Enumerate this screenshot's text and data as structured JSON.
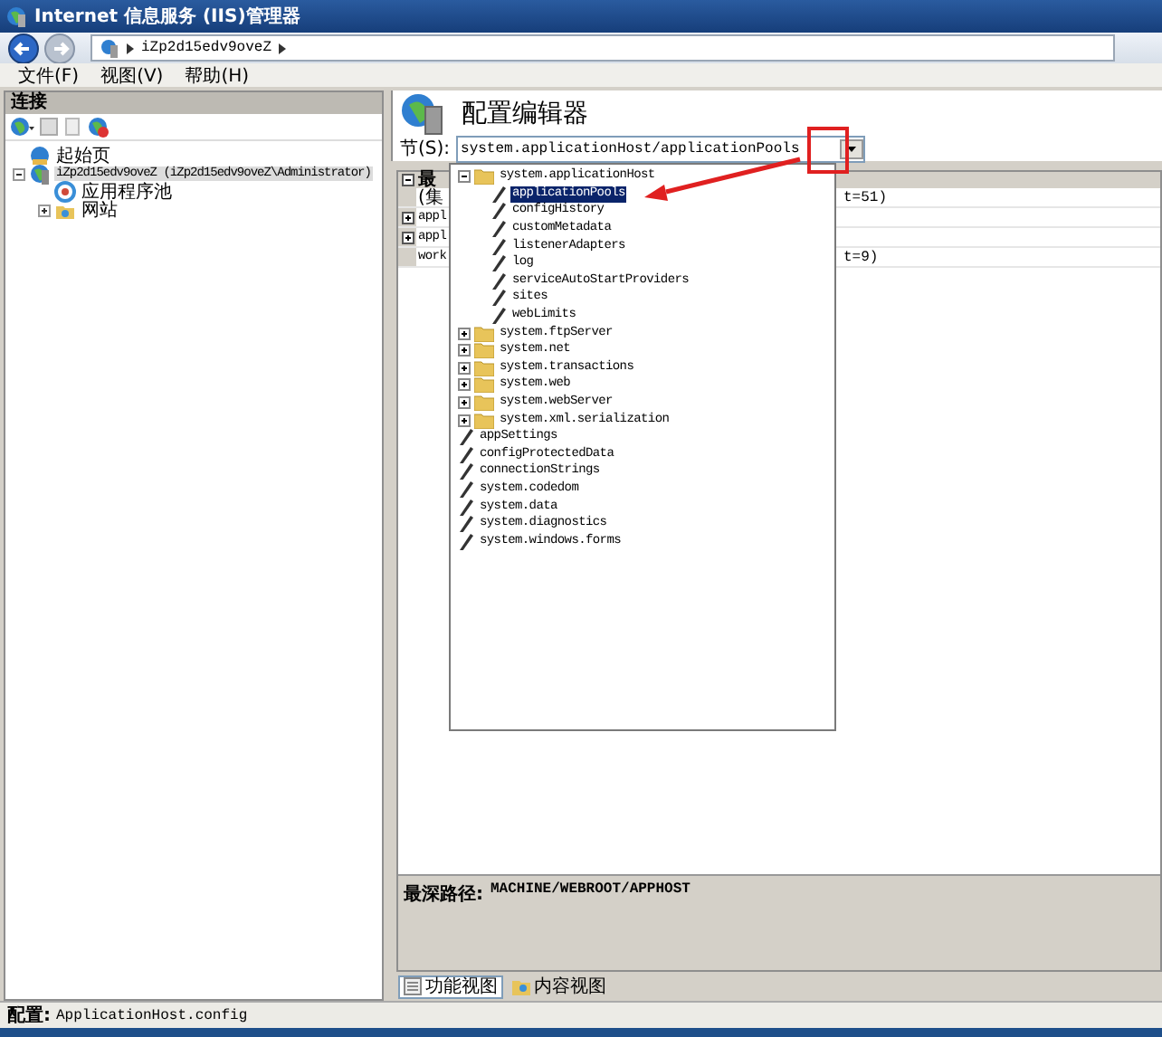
{
  "window": {
    "title": "Internet 信息服务 (IIS)管理器"
  },
  "address": {
    "segments": [
      "iZp2d15edv9oveZ"
    ]
  },
  "menu": [
    "文件(F)",
    "视图(V)",
    "帮助(H)"
  ],
  "connections": {
    "title": "连接",
    "tree": [
      {
        "label": "起始页",
        "kind": "start",
        "selected": false
      },
      {
        "label": "iZp2d15edv9oveZ (iZp2d15edv9oveZ\\Administrator)",
        "kind": "server",
        "expanded": true,
        "selected": true,
        "children": [
          {
            "label": "应用程序池",
            "kind": "pools",
            "selected": false
          },
          {
            "label": "网站",
            "kind": "sites",
            "expanded": false,
            "selected": false
          }
        ]
      }
    ]
  },
  "editor": {
    "title": "配置编辑器",
    "section_label": "节(S):",
    "section_value": "system.applicationHost/applicationPools",
    "grid": {
      "header": "最",
      "rows": [
        {
          "expander": false,
          "name": "(集",
          "value": "t=51)"
        },
        {
          "expander": true,
          "name": "appl"
        },
        {
          "expander": true,
          "name": "appl"
        },
        {
          "expander": false,
          "name": "work",
          "value": "t=9)"
        }
      ]
    },
    "path_label": "最深路径:",
    "path_value": "MACHINE/WEBROOT/APPHOST"
  },
  "dropdown": {
    "tree": [
      {
        "label": "system.applicationHost",
        "kind": "folder",
        "expanded": true,
        "selected": false,
        "children": [
          {
            "label": "applicationPools",
            "kind": "leaf",
            "selected": true
          },
          {
            "label": "configHistory",
            "kind": "leaf",
            "selected": false
          },
          {
            "label": "customMetadata",
            "kind": "leaf",
            "selected": false
          },
          {
            "label": "listenerAdapters",
            "kind": "leaf",
            "selected": false
          },
          {
            "label": "log",
            "kind": "leaf",
            "selected": false
          },
          {
            "label": "serviceAutoStartProviders",
            "kind": "leaf",
            "selected": false
          },
          {
            "label": "sites",
            "kind": "leaf",
            "selected": false
          },
          {
            "label": "webLimits",
            "kind": "leaf",
            "selected": false
          }
        ]
      },
      {
        "label": "system.ftpServer",
        "kind": "folder",
        "expanded": false,
        "selected": false
      },
      {
        "label": "system.net",
        "kind": "folder",
        "expanded": false,
        "selected": false
      },
      {
        "label": "system.transactions",
        "kind": "folder",
        "expanded": false,
        "selected": false
      },
      {
        "label": "system.web",
        "kind": "folder",
        "expanded": false,
        "selected": false
      },
      {
        "label": "system.webServer",
        "kind": "folder",
        "expanded": false,
        "selected": false
      },
      {
        "label": "system.xml.serialization",
        "kind": "folder",
        "expanded": false,
        "selected": false
      },
      {
        "label": "appSettings",
        "kind": "leaf",
        "selected": false
      },
      {
        "label": "configProtectedData",
        "kind": "leaf",
        "selected": false
      },
      {
        "label": "connectionStrings",
        "kind": "leaf",
        "selected": false
      },
      {
        "label": "system.codedom",
        "kind": "leaf",
        "selected": false
      },
      {
        "label": "system.data",
        "kind": "leaf",
        "selected": false
      },
      {
        "label": "system.diagnostics",
        "kind": "leaf",
        "selected": false
      },
      {
        "label": "system.windows.forms",
        "kind": "leaf",
        "selected": false
      }
    ]
  },
  "view_tabs": [
    {
      "label": "功能视图",
      "selected": true
    },
    {
      "label": "内容视图",
      "selected": false
    }
  ],
  "status_bar": {
    "label": "配置:",
    "value": "ApplicationHost.config"
  }
}
